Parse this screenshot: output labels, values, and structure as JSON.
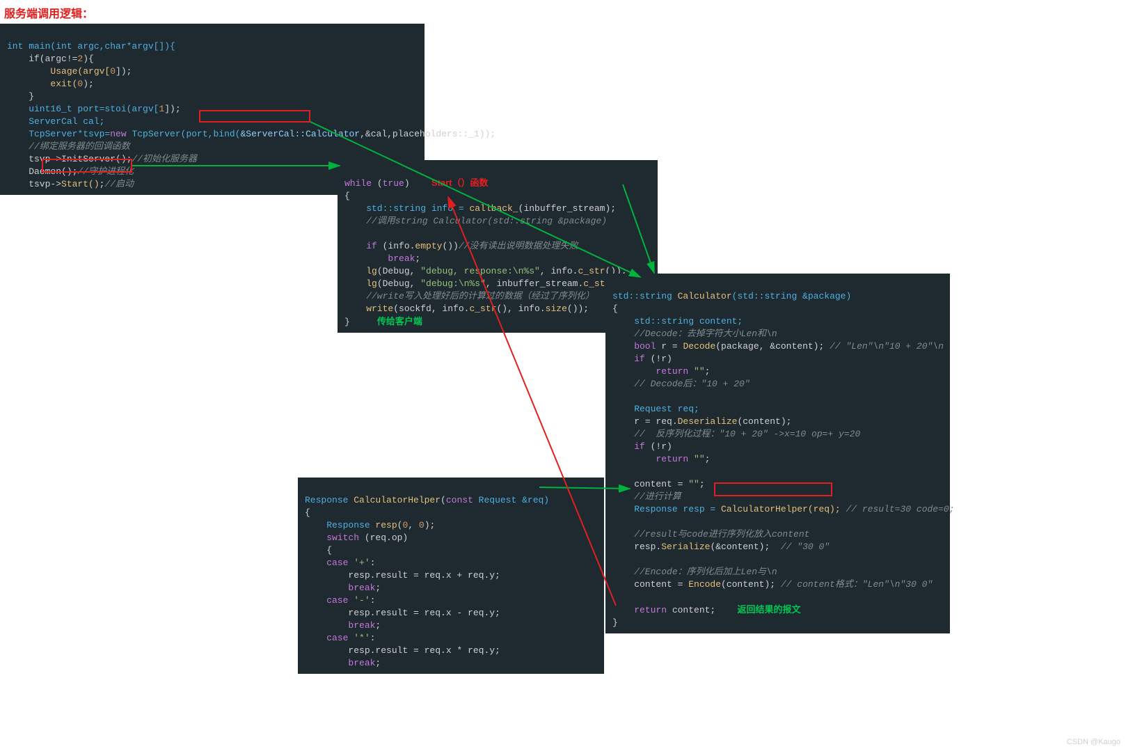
{
  "title": "服务端调用逻辑：",
  "watermark": "CSDN @Kaugo",
  "block1": {
    "l0": "int main(int argc,char*argv[]){",
    "l1a": "    if(argc!=",
    "l1b": "2",
    "l1c": "){",
    "l2a": "        Usage(argv[",
    "l2b": "0",
    "l2c": "]);",
    "l3a": "        exit(",
    "l3b": "0",
    "l3c": ");",
    "l4": "    }",
    "l5a": "    uint16_t port=stoi(argv[",
    "l5b": "1",
    "l5c": "]);",
    "l6": "    ServerCal cal;",
    "l7a": "    TcpServer*tsvp=",
    "l7b": "new",
    "l7c": " TcpServer(port,bind(",
    "l7d": "&ServerCal::Calculator",
    "l7e": ",&cal,placeholders::_1));",
    "l8": "    //绑定服务器的回调函数",
    "l9a": "    tsvp->InitServer();",
    "l9b": "//初始化服务器",
    "l10a": "    Daemon();",
    "l10b": "//守护进程化",
    "l11a": "    tsvp->",
    "l11b": "Start()",
    "l11c": ";",
    "l11d": "//启动"
  },
  "block2": {
    "title": "Start（）函数",
    "pass_label": "传给客户端",
    "l0a": "while",
    "l0b": " (",
    "l0c": "true",
    "l0d": ")",
    "l1": "{",
    "l2a": "    std::string info = ",
    "l2b": "callback_",
    "l2c": "(inbuffer_stream);",
    "l3": "    //调用string Calculator(std::string &package)",
    "l4": "",
    "l5a": "    if",
    "l5b": " (info.",
    "l5c": "empty",
    "l5d": "())",
    "l5e": "//没有读出说明数据处理失败",
    "l6a": "        break",
    "l6b": ";",
    "l7a": "    lg",
    "l7b": "(Debug, ",
    "l7c": "\"debug, response:\\n%s\"",
    "l7d": ", info.",
    "l7e": "c_str",
    "l7f": "());",
    "l8a": "    lg",
    "l8b": "(Debug, ",
    "l8c": "\"debug:\\n%s\"",
    "l8d": ", inbuffer_stream.",
    "l8e": "c_str",
    "l8f": "());",
    "l9": "    //write写入处理好后的计算过的数据（经过了序列化）",
    "l10a": "    write",
    "l10b": "(sockfd, info.",
    "l10c": "c_str",
    "l10d": "(), info.",
    "l10e": "size",
    "l10f": "());",
    "l11": "}"
  },
  "block3": {
    "ret_label": "返回结果的报文",
    "l0a": "std::string ",
    "l0b": "Calculator",
    "l0c": "(std::string &package)",
    "l1": "{",
    "l2": "    std::string content;",
    "l3": "    //Decode：去掉字符大小Len和\\n",
    "l4a": "    bool",
    "l4b": " r = ",
    "l4c": "Decode",
    "l4d": "(package, &content); ",
    "l4e": "// \"Len\"\\n\"10 + 20\"\\n",
    "l5a": "    if",
    "l5b": " (!r)",
    "l6a": "        return",
    "l6b": " ",
    "l6c": "\"\"",
    "l6d": ";",
    "l7": "    // Decode后：\"10 + 20\"",
    "l8": "",
    "l9": "    Request req;",
    "l10a": "    r = req.",
    "l10b": "Deserialize",
    "l10c": "(content);",
    "l11": "    //  反序列化过程：\"10 + 20\" ->x=10 op=+ y=20",
    "l12a": "    if",
    "l12b": " (!r)",
    "l13a": "        return",
    "l13b": " ",
    "l13c": "\"\"",
    "l13d": ";",
    "l14": "",
    "l15a": "    content = ",
    "l15b": "\"\"",
    "l15c": ";",
    "l16": "    //进行计算",
    "l17a": "    Response resp = ",
    "l17b": "CalculatorHelper(req);",
    "l17c": " // result=30 code=0;",
    "l18": "",
    "l19": "    //result与code进行序列化放入content",
    "l20a": "    resp.",
    "l20b": "Serialize",
    "l20c": "(&content);  ",
    "l20d": "// \"30 0\"",
    "l21": "",
    "l22": "    //Encode：序列化后加上Len与\\n",
    "l23a": "    content = ",
    "l23b": "Encode",
    "l23c": "(content); ",
    "l23d": "// content格式：\"Len\"\\n\"30 0\"",
    "l24": "",
    "l25a": "    return",
    "l25b": " content;",
    "l26": "}"
  },
  "block4": {
    "l0a": "Response ",
    "l0b": "CalculatorHelper",
    "l0c": "(",
    "l0d": "const",
    "l0e": " Request &req)",
    "l1": "{",
    "l2a": "    Response ",
    "l2b": "resp",
    "l2c": "(",
    "l2d": "0",
    "l2e": ", ",
    "l2f": "0",
    "l2g": ");",
    "l3a": "    switch",
    "l3b": " (req.op)",
    "l4": "    {",
    "l5a": "    case",
    "l5b": " ",
    "l5c": "'+'",
    "l5d": ":",
    "l6": "        resp.result = req.x + req.y;",
    "l7a": "        break",
    "l7b": ";",
    "l8a": "    case",
    "l8b": " ",
    "l8c": "'-'",
    "l8d": ":",
    "l9": "        resp.result = req.x - req.y;",
    "l10a": "        break",
    "l10b": ";",
    "l11a": "    case",
    "l11b": " ",
    "l11c": "'*'",
    "l11d": ":",
    "l12": "        resp.result = req.x * req.y;",
    "l13a": "        break",
    "l13b": ";"
  }
}
